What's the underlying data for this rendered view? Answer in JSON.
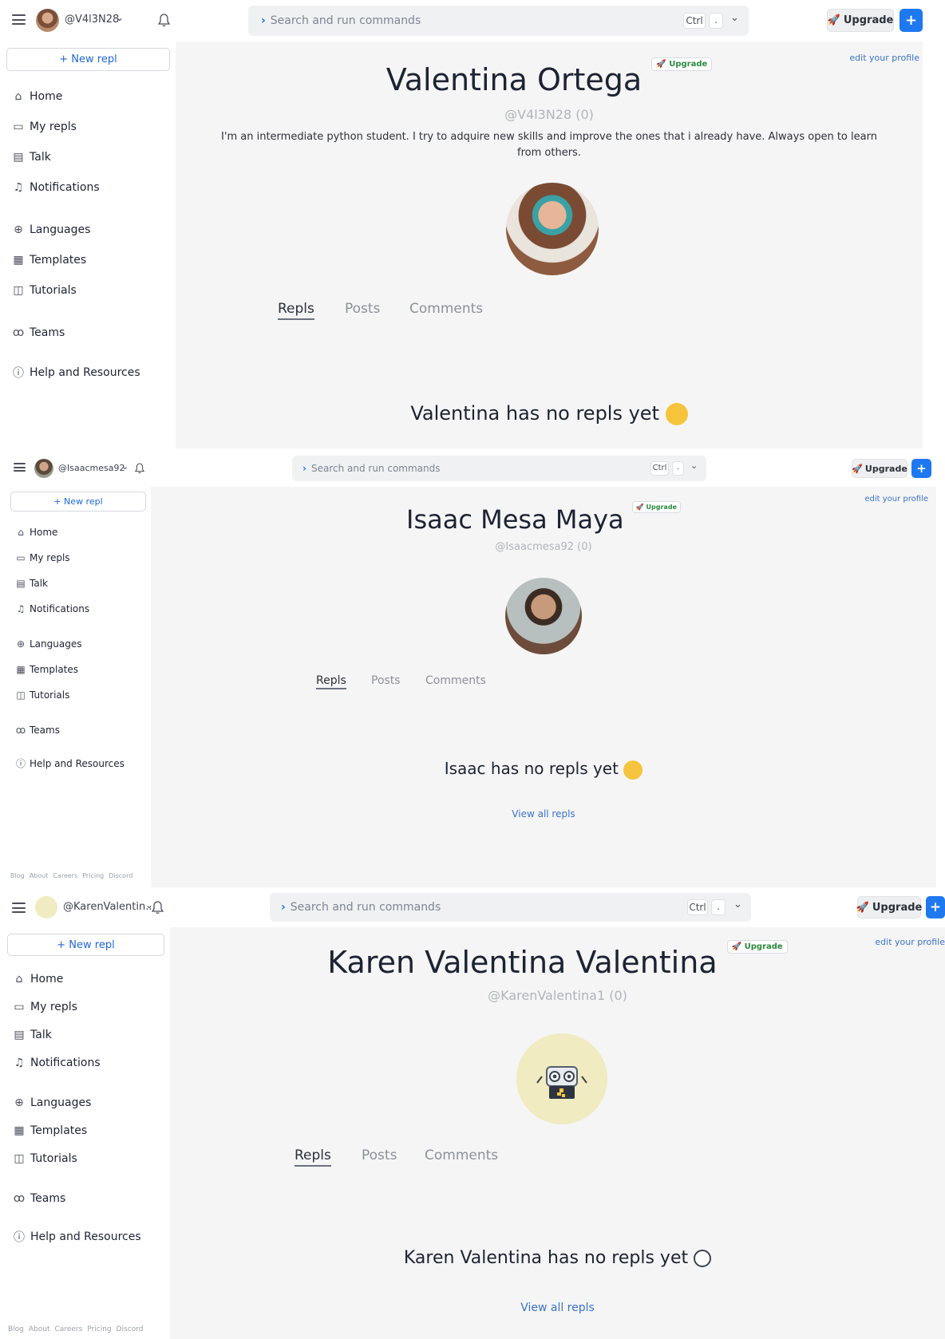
{
  "profiles": [
    {
      "username": "@V4l3N28",
      "search_placeholder": "Search and run commands",
      "kbd_ctrl": "Ctrl",
      "kbd_dot": ".",
      "upgrade_label": "Upgrade",
      "new_repl_label": "+ New repl",
      "nav": [
        "Home",
        "My repls",
        "Talk",
        "Notifications",
        "Languages",
        "Templates",
        "Tutorials",
        "Teams",
        "Help and Resources"
      ],
      "name": "Valentina Ortega",
      "badge": "Upgrade",
      "handle": "@V4l3N28 (0)",
      "bio": "I'm an intermediate python student. I try to adquire new skills and improve the ones that i already have. Always open to learn from others.",
      "edit_profile": "edit your profile",
      "tabs": [
        "Repls",
        "Posts",
        "Comments"
      ],
      "empty_message": "Valentina has no repls yet"
    },
    {
      "username": "@Isaacmesa92",
      "search_placeholder": "Search and run commands",
      "kbd_ctrl": "Ctrl",
      "kbd_dot": ".",
      "upgrade_label": "Upgrade",
      "new_repl_label": "+ New repl",
      "nav": [
        "Home",
        "My repls",
        "Talk",
        "Notifications",
        "Languages",
        "Templates",
        "Tutorials",
        "Teams",
        "Help and Resources"
      ],
      "name": "Isaac Mesa Maya",
      "badge": "Upgrade",
      "handle": "@Isaacmesa92 (0)",
      "edit_profile": "edit your profile",
      "tabs": [
        "Repls",
        "Posts",
        "Comments"
      ],
      "empty_message": "Isaac has no repls yet",
      "view_all": "View all repls",
      "footer": [
        "Blog",
        "About",
        "Careers",
        "Pricing",
        "Discord"
      ]
    },
    {
      "username": "@KarenValentin...",
      "search_placeholder": "Search and run commands",
      "kbd_ctrl": "Ctrl",
      "kbd_dot": ".",
      "upgrade_label": "Upgrade",
      "new_repl_label": "+ New repl",
      "nav": [
        "Home",
        "My repls",
        "Talk",
        "Notifications",
        "Languages",
        "Templates",
        "Tutorials",
        "Teams",
        "Help and Resources"
      ],
      "name": "Karen Valentina Valentina",
      "badge": "Upgrade",
      "handle": "@KarenValentina1 (0)",
      "edit_profile": "edit your profile",
      "tabs": [
        "Repls",
        "Posts",
        "Comments"
      ],
      "empty_message": "Karen Valentina has no repls yet",
      "view_all": "View all repls",
      "footer": [
        "Blog",
        "About",
        "Careers",
        "Pricing",
        "Discord"
      ]
    }
  ],
  "colors": {
    "accent": "#1e78f0",
    "link": "#3a73c9",
    "badge_green": "#2a8a3e",
    "main_bg": "#f5f5f5"
  },
  "icons": {
    "nav": [
      "home-icon",
      "folder-icon",
      "talk-icon",
      "bell-icon",
      "globe-icon",
      "templates-icon",
      "book-icon",
      "teams-icon",
      "info-icon"
    ]
  }
}
